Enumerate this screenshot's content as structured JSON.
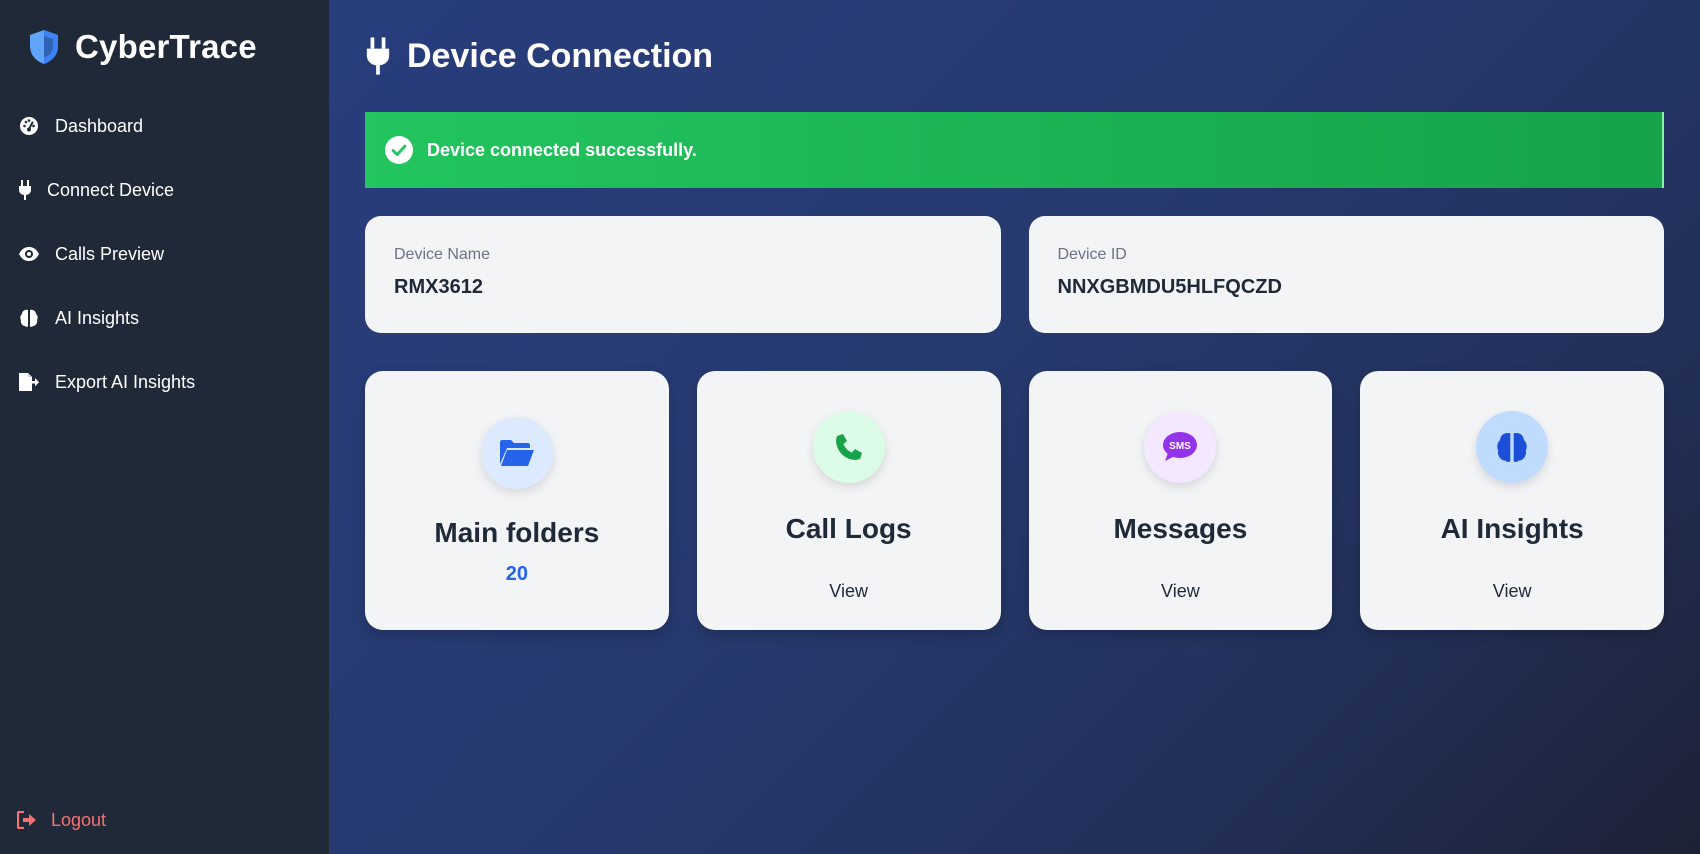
{
  "sidebar": {
    "brand": "CyberTrace",
    "items": [
      {
        "label": "Dashboard",
        "icon": "gauge-icon"
      },
      {
        "label": "Connect Device",
        "icon": "plug-icon"
      },
      {
        "label": "Calls Preview",
        "icon": "eye-icon"
      },
      {
        "label": "AI Insights",
        "icon": "brain-icon"
      },
      {
        "label": "Export AI Insights",
        "icon": "file-export-icon"
      }
    ],
    "logout": "Logout"
  },
  "main": {
    "title": "Device Connection",
    "alert": "Device connected successfully.",
    "device_name_label": "Device Name",
    "device_name": "RMX3612",
    "device_id_label": "Device ID",
    "device_id": "NNXGBMDU5HLFQCZD",
    "tiles": [
      {
        "title": "Main folders",
        "sub": "20",
        "icon": "folder-open-icon"
      },
      {
        "title": "Call Logs",
        "sub": "View",
        "icon": "phone-icon"
      },
      {
        "title": "Messages",
        "sub": "View",
        "icon": "sms-icon"
      },
      {
        "title": "AI Insights",
        "sub": "View",
        "icon": "brain-icon"
      }
    ]
  },
  "colors": {
    "sidebar_bg": "#1f2937",
    "success": "#22c55e",
    "logout": "#f87171",
    "accent_blue": "#2563eb"
  }
}
